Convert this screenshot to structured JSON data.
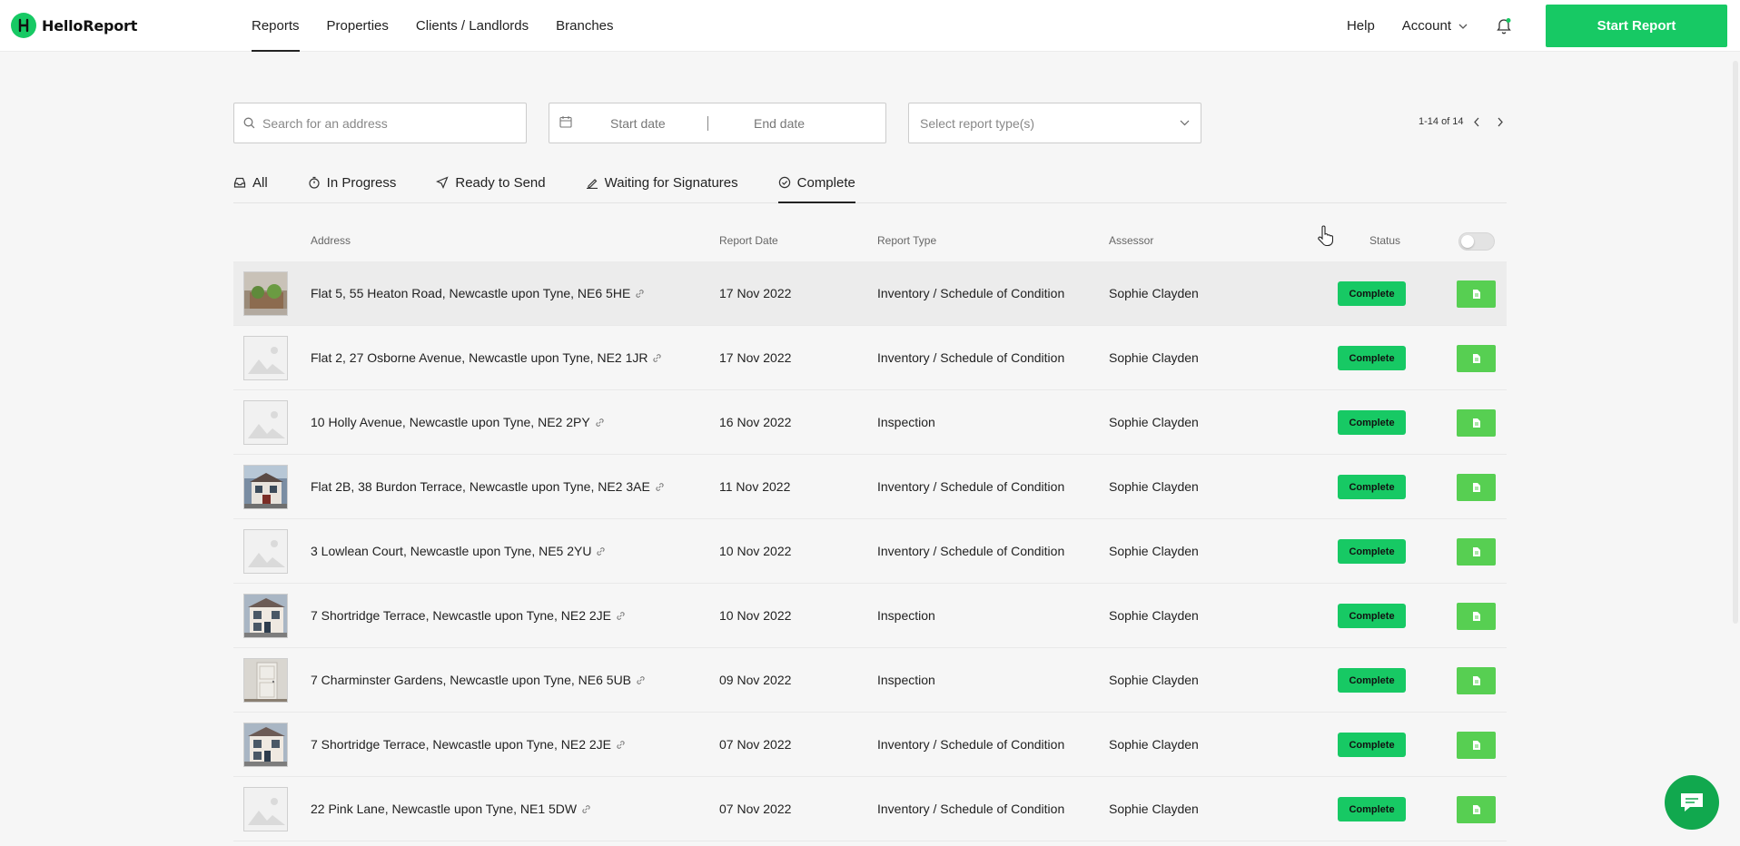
{
  "app": {
    "logo_text": "HelloReport"
  },
  "nav": {
    "items": [
      {
        "label": "Reports",
        "active": true
      },
      {
        "label": "Properties",
        "active": false
      },
      {
        "label": "Clients / Landlords",
        "active": false
      },
      {
        "label": "Branches",
        "active": false
      }
    ],
    "help": "Help",
    "account": "Account",
    "start_report": "Start Report"
  },
  "filters": {
    "search_placeholder": "Search for an address",
    "start_date_placeholder": "Start date",
    "end_date_placeholder": "End date",
    "report_type_placeholder": "Select report type(s)"
  },
  "pagination": {
    "range": "1-14 of 14"
  },
  "tabs": [
    {
      "label": "All",
      "icon": "inbox-icon",
      "active": false
    },
    {
      "label": "In Progress",
      "icon": "stopwatch-icon",
      "active": false
    },
    {
      "label": "Ready to Send",
      "icon": "send-icon",
      "active": false
    },
    {
      "label": "Waiting for Signatures",
      "icon": "signature-icon",
      "active": false
    },
    {
      "label": "Complete",
      "icon": "check-circle-icon",
      "active": true
    }
  ],
  "table": {
    "headers": {
      "address": "Address",
      "date": "Report Date",
      "type": "Report Type",
      "assessor": "Assessor",
      "status": "Status"
    },
    "rows": [
      {
        "address": "Flat 5, 55 Heaton Road, Newcastle upon Tyne, NE6 5HE",
        "date": "17 Nov 2022",
        "type": "Inventory / Schedule of Condition",
        "assessor": "Sophie Clayden",
        "status": "Complete",
        "thumb": "photo-plants"
      },
      {
        "address": "Flat 2, 27 Osborne Avenue, Newcastle upon Tyne, NE2 1JR",
        "date": "17 Nov 2022",
        "type": "Inventory / Schedule of Condition",
        "assessor": "Sophie Clayden",
        "status": "Complete",
        "thumb": "placeholder"
      },
      {
        "address": "10 Holly Avenue, Newcastle upon Tyne, NE2 2PY",
        "date": "16 Nov 2022",
        "type": "Inspection",
        "assessor": "Sophie Clayden",
        "status": "Complete",
        "thumb": "placeholder"
      },
      {
        "address": "Flat 2B, 38 Burdon Terrace, Newcastle upon Tyne, NE2 3AE",
        "date": "11 Nov 2022",
        "type": "Inventory / Schedule of Condition",
        "assessor": "Sophie Clayden",
        "status": "Complete",
        "thumb": "photo-house"
      },
      {
        "address": "3 Lowlean Court, Newcastle upon Tyne, NE5 2YU",
        "date": "10 Nov 2022",
        "type": "Inventory / Schedule of Condition",
        "assessor": "Sophie Clayden",
        "status": "Complete",
        "thumb": "placeholder"
      },
      {
        "address": "7 Shortridge Terrace, Newcastle upon Tyne, NE2 2JE",
        "date": "10 Nov 2022",
        "type": "Inspection",
        "assessor": "Sophie Clayden",
        "status": "Complete",
        "thumb": "photo-terrace"
      },
      {
        "address": "7 Charminster Gardens, Newcastle upon Tyne, NE6 5UB",
        "date": "09 Nov 2022",
        "type": "Inspection",
        "assessor": "Sophie Clayden",
        "status": "Complete",
        "thumb": "photo-door"
      },
      {
        "address": "7 Shortridge Terrace, Newcastle upon Tyne, NE2 2JE",
        "date": "07 Nov 2022",
        "type": "Inventory / Schedule of Condition",
        "assessor": "Sophie Clayden",
        "status": "Complete",
        "thumb": "photo-terrace"
      },
      {
        "address": "22 Pink Lane, Newcastle upon Tyne, NE1 5DW",
        "date": "07 Nov 2022",
        "type": "Inventory / Schedule of Condition",
        "assessor": "Sophie Clayden",
        "status": "Complete",
        "thumb": "placeholder"
      }
    ]
  },
  "colors": {
    "brand": "#17c964",
    "doc_button": "#57cf52",
    "chat": "#11a84e"
  }
}
